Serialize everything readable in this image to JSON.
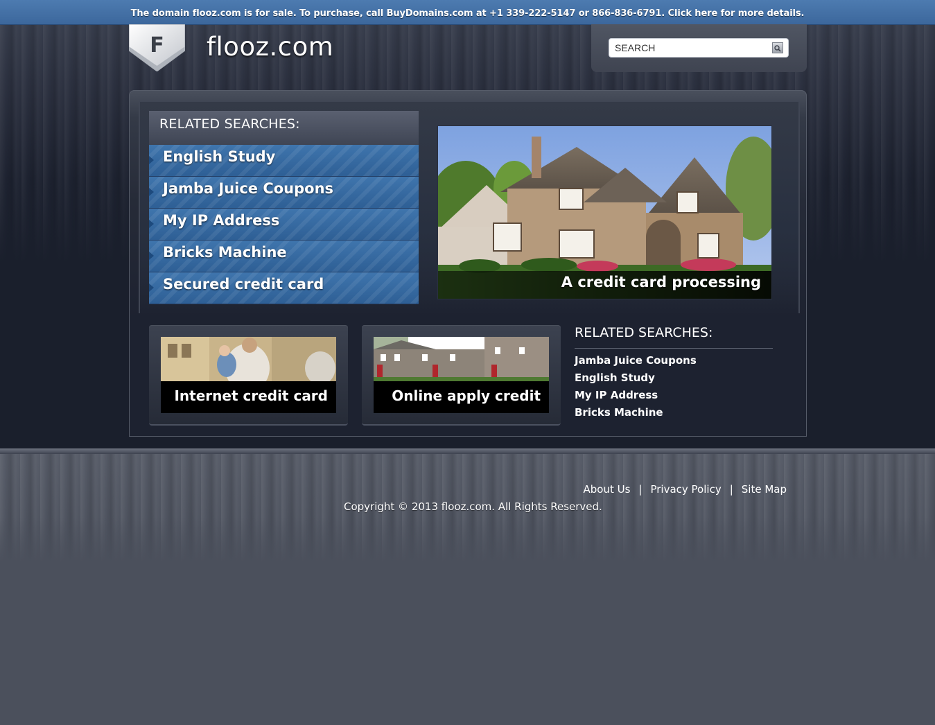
{
  "banner": {
    "text": "The domain flooz.com is for sale. To purchase, call BuyDomains.com at +1 339-222-5147 or 866-836-6791. Click here for more details."
  },
  "logo": {
    "letter": "F",
    "site_name": "flooz.com"
  },
  "search": {
    "placeholder": "SEARCH"
  },
  "related_main": {
    "title": "RELATED SEARCHES:",
    "items": [
      {
        "label": "English Study"
      },
      {
        "label": "Jamba Juice Coupons"
      },
      {
        "label": "My IP Address"
      },
      {
        "label": "Bricks Machine"
      },
      {
        "label": "Secured credit card"
      }
    ]
  },
  "hero": {
    "caption": "A credit card processing"
  },
  "thumbnails": [
    {
      "caption": "Internet credit card"
    },
    {
      "caption": "Online apply credit"
    }
  ],
  "related_side": {
    "title": "RELATED SEARCHES:",
    "items": [
      {
        "label": "Jamba Juice Coupons"
      },
      {
        "label": "English Study"
      },
      {
        "label": "My IP Address"
      },
      {
        "label": "Bricks Machine"
      }
    ]
  },
  "footer": {
    "links": [
      {
        "label": "About Us"
      },
      {
        "label": "Privacy Policy"
      },
      {
        "label": "Site Map"
      }
    ],
    "separator": "|",
    "copyright": "Copyright © 2013 flooz.com. All Rights Reserved."
  },
  "colors": {
    "banner": "#3c679c",
    "link_item": "#2e5f95",
    "page_bg": "#4b505c"
  }
}
